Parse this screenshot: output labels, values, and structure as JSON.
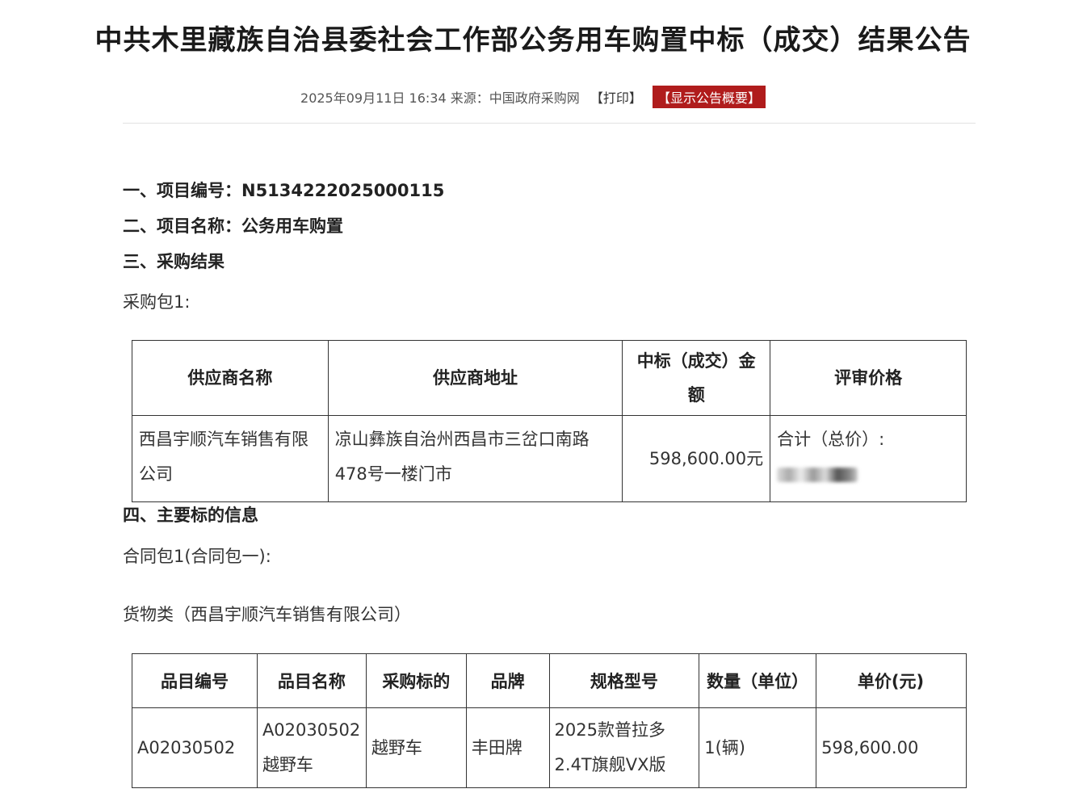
{
  "title": "中共木里藏族自治县委社会工作部公务用车购置中标（成交）结果公告",
  "meta": {
    "datetime": "2025年09月11日 16:34",
    "source": "来源：中国政府采购网",
    "print": "【打印】",
    "summary": "【显示公告概要】"
  },
  "sections": {
    "s1": "一、项目编号：N5134222025000115",
    "s2": "二、项目名称：公务用车购置",
    "s3": "三、采购结果",
    "pkg": "采购包1:",
    "s4": "四、主要标的信息",
    "contract": "合同包1(合同包一):",
    "goods": "货物类（西昌宇顺汽车销售有限公司）"
  },
  "table1": {
    "headers": [
      "供应商名称",
      "供应商地址",
      "中标（成交）金额",
      "评审价格"
    ],
    "row": {
      "supplier": "西昌宇顺汽车销售有限公司",
      "address": "凉山彝族自治州西昌市三岔口南路478号一楼门市",
      "amount": "598,600.00元",
      "review": "合计（总价）:"
    }
  },
  "table2": {
    "headers": [
      "品目编号",
      "品目名称",
      "采购标的",
      "品牌",
      "规格型号",
      "数量（单位）",
      "单价(元)"
    ],
    "row": {
      "code": "A02030502",
      "name": "A02030502越野车",
      "target": "越野车",
      "brand": "丰田牌",
      "model": "2025款普拉多2.4T旗舰VX版",
      "qty": "1(辆)",
      "price": "598,600.00"
    }
  }
}
